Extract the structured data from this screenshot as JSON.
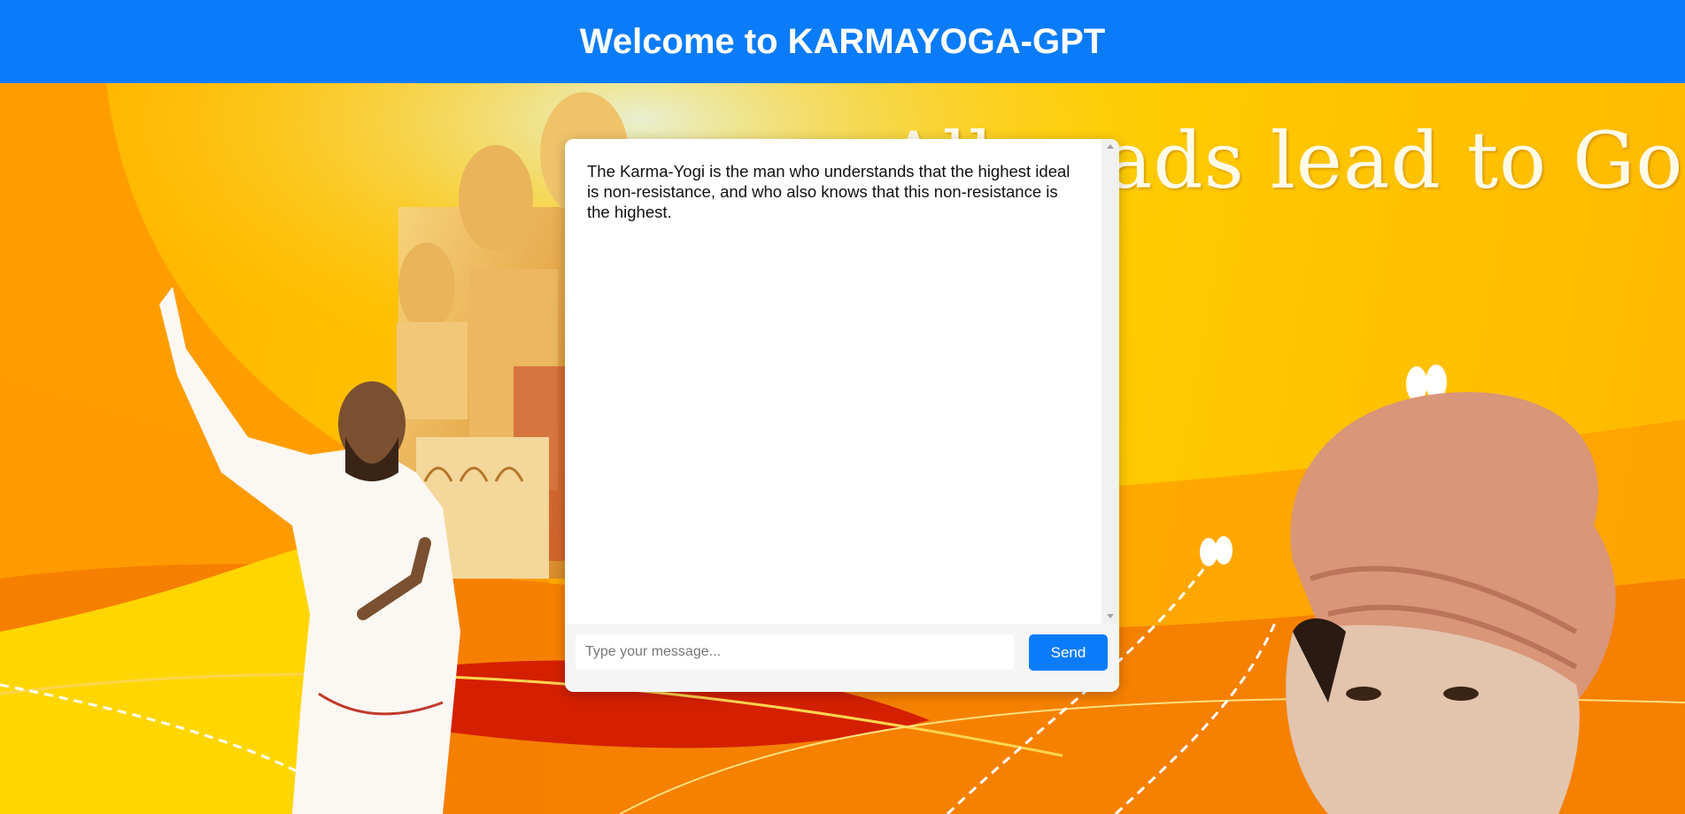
{
  "header": {
    "title": "Welcome to KARMAYOGA-GPT"
  },
  "background": {
    "tagline": "All roads lead to God",
    "colors": {
      "header": "#0a7cf9",
      "orange": "#ff8c00",
      "yellow": "#ffc400",
      "red": "#d42000"
    }
  },
  "chat": {
    "messages": [
      {
        "text": "The Karma-Yogi is the man who understands that the highest ideal is non-resistance, and who also knows that this non-resistance is the highest."
      }
    ],
    "input": {
      "placeholder": "Type your message...",
      "value": ""
    },
    "send_label": "Send"
  }
}
